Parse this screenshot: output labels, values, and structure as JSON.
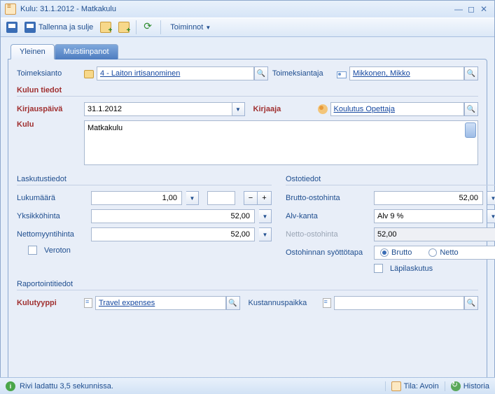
{
  "window": {
    "title": "Kulu: 31.1.2012 - Matkakulu"
  },
  "toolbar": {
    "save_close": "Tallenna ja sulje",
    "actions": "Toiminnot"
  },
  "tabs": {
    "general": "Yleinen",
    "notes": "Muistiinpanot"
  },
  "top": {
    "assignment_label": "Toimeksianto",
    "assignment_value": "4 - Laiton irtisanominen",
    "client_label": "Toimeksiantaja",
    "client_value": "Mikkonen, Mikko"
  },
  "section_details": "Kulun tiedot",
  "details": {
    "date_label": "Kirjauspäivä",
    "date_value": "31.1.2012",
    "author_label": "Kirjaaja",
    "author_value": "Koulutus Opettaja",
    "expense_label": "Kulu",
    "expense_value": "Matkakulu"
  },
  "section_billing": "Laskutustiedot",
  "billing": {
    "qty_label": "Lukumäärä",
    "qty_value": "1,00",
    "unitprice_label": "Yksikköhinta",
    "unitprice_value": "52,00",
    "netsale_label": "Nettomyyntihinta",
    "netsale_value": "52,00",
    "taxfree_label": "Veroton"
  },
  "section_purchase": "Ostotiedot",
  "purchase": {
    "gross_label": "Brutto-ostohinta",
    "gross_value": "52,00",
    "vat_label": "Alv-kanta",
    "vat_value": "Alv 9 %",
    "net_label": "Netto-ostohinta",
    "net_value": "52,00",
    "entry_label": "Ostohinnan syöttötapa",
    "entry_brutto": "Brutto",
    "entry_netto": "Netto",
    "passthrough_label": "Läpilaskutus"
  },
  "section_report": "Raportointitiedot",
  "report": {
    "type_label": "Kulutyyppi",
    "type_value": "Travel expenses",
    "costcenter_label": "Kustannuspaikka",
    "costcenter_value": ""
  },
  "status": {
    "loaded": "Rivi ladattu 3,5 sekunnissa.",
    "state": "Tila: Avoin",
    "history": "Historia"
  }
}
